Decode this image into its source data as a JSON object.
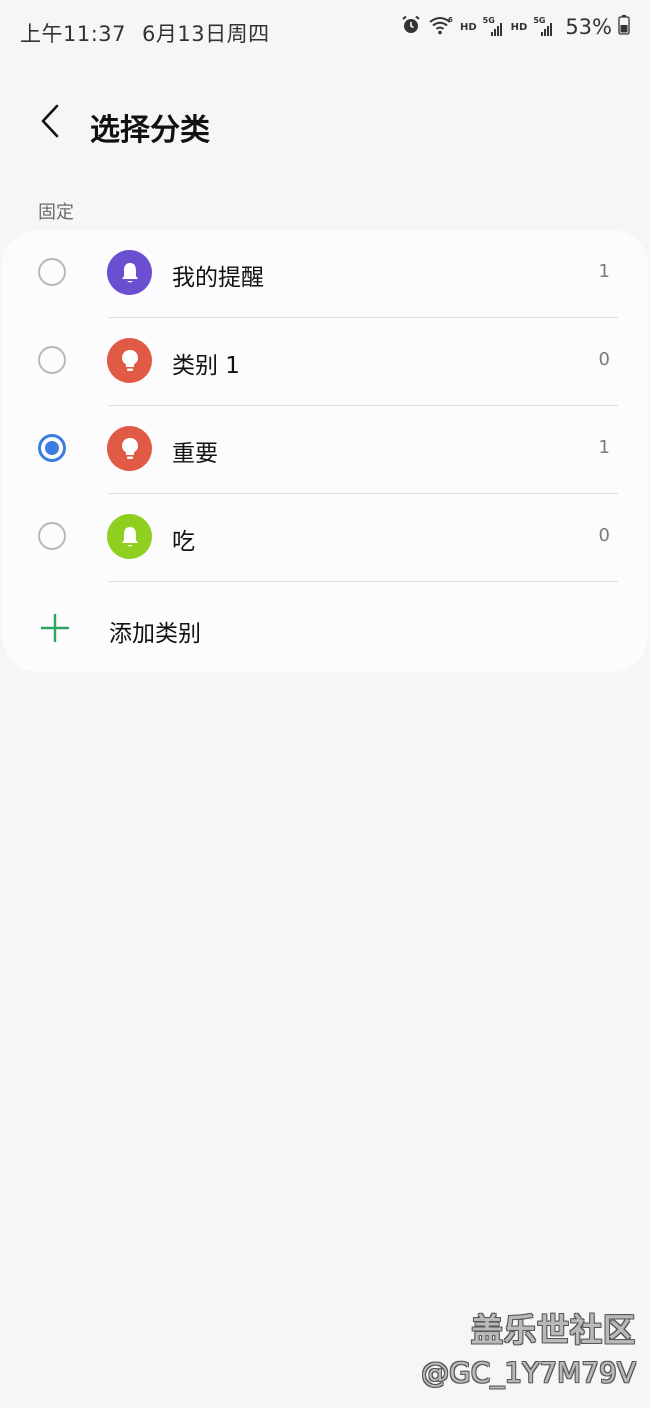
{
  "status_bar": {
    "time": "上午11:37",
    "date": "6月13日周四",
    "hd_1": "HD",
    "sig_1": "5G",
    "hd_2": "HD",
    "sig_2": "5G",
    "battery": "53%",
    "icons": [
      "alarm-icon",
      "wifi-icon",
      "signal-icon",
      "signal-icon",
      "battery-icon"
    ]
  },
  "header": {
    "title": "选择分类",
    "back_icon": "chevron-left-icon"
  },
  "section": {
    "label": "固定"
  },
  "categories": [
    {
      "label": "我的提醒",
      "count": "1",
      "color": "#6a4fd0",
      "icon": "bell-icon",
      "selected": false
    },
    {
      "label": "类别 1",
      "count": "0",
      "color": "#e05a45",
      "icon": "lightbulb-icon",
      "selected": false
    },
    {
      "label": "重要",
      "count": "1",
      "color": "#e05a45",
      "icon": "lightbulb-icon",
      "selected": true
    },
    {
      "label": "吃",
      "count": "0",
      "color": "#8fcf1f",
      "icon": "bell-icon",
      "selected": false
    }
  ],
  "add_category": {
    "label": "添加类别",
    "icon": "plus-icon",
    "color": "#2aa562"
  },
  "colors": {
    "accent": "#3b7de0",
    "background": "#f6f6f8"
  },
  "watermark": {
    "title": "盖乐世社区",
    "user": "@GC_1Y7M79V"
  }
}
